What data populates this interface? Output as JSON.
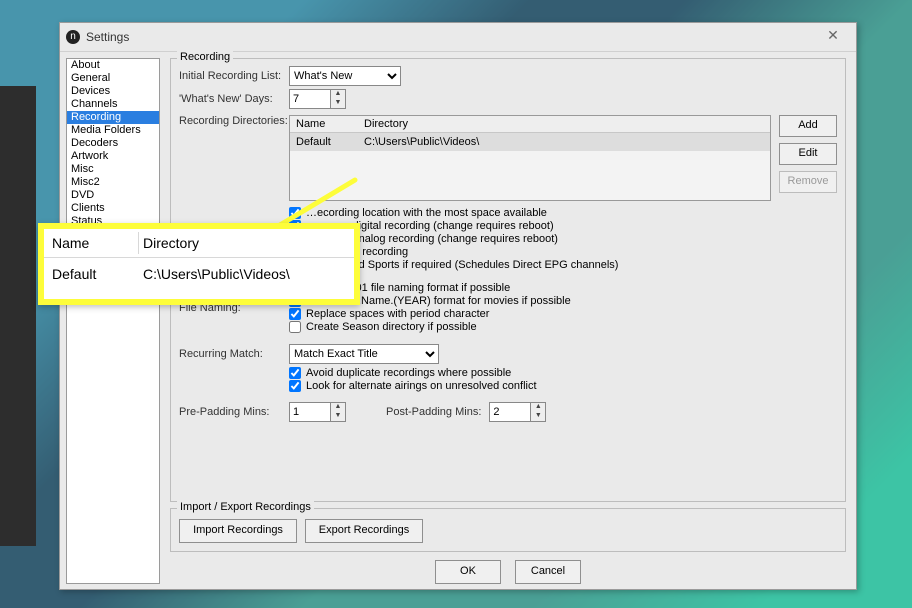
{
  "window": {
    "title": "Settings"
  },
  "sidebar": {
    "items": [
      "About",
      "General",
      "Devices",
      "Channels",
      "Recording",
      "Media Folders",
      "Decoders",
      "Artwork",
      "Misc",
      "Misc2",
      "DVD",
      "Clients",
      "Status"
    ],
    "selected_index": 4
  },
  "recording": {
    "group_label": "Recording",
    "initial_list_label": "Initial Recording List:",
    "initial_list_value": "What's New",
    "whats_new_days_label": "'What's New' Days:",
    "whats_new_days_value": "7",
    "rec_dirs_label": "Recording Directories:",
    "table": {
      "head_name": "Name",
      "head_dir": "Directory",
      "row_name": "Default",
      "row_dir": "C:\\Users\\Public\\Videos\\"
    },
    "btn_add": "Add",
    "btn_edit": "Edit",
    "btn_remove": "Remove",
    "opt_most_space": "…ecording location with the most space available",
    "opt_digital": "…rocess digital recording (change requires reboot)",
    "opt_analog": "…rocess analog recording (change requires reboot)",
    "opt_shutdown": "…wn while recording",
    "opt_autoextend": "Auto extend Sports if required (Schedules Direct EPG channels)",
    "file_naming_label": "File Naming:",
    "fn1": "Use S01E01 file naming format if possible",
    "fn2": "Use Movie.Name.(YEAR) format for movies if possible",
    "fn3": "Replace spaces with period character",
    "fn4": "Create Season directory if possible",
    "recurring_label": "Recurring Match:",
    "recurring_value": "Match Exact Title",
    "rm1": "Avoid duplicate recordings where possible",
    "rm2": "Look for alternate airings on unresolved conflict",
    "pre_pad_label": "Pre-Padding Mins:",
    "pre_pad_value": "1",
    "post_pad_label": "Post-Padding Mins:",
    "post_pad_value": "2"
  },
  "import_export": {
    "group_label": "Import / Export Recordings",
    "btn_import": "Import Recordings",
    "btn_export": "Export Recordings"
  },
  "buttons": {
    "ok": "OK",
    "cancel": "Cancel"
  },
  "callout": {
    "head_name": "Name",
    "head_dir": "Directory",
    "row_name": "Default",
    "row_dir": "C:\\Users\\Public\\Videos\\"
  }
}
